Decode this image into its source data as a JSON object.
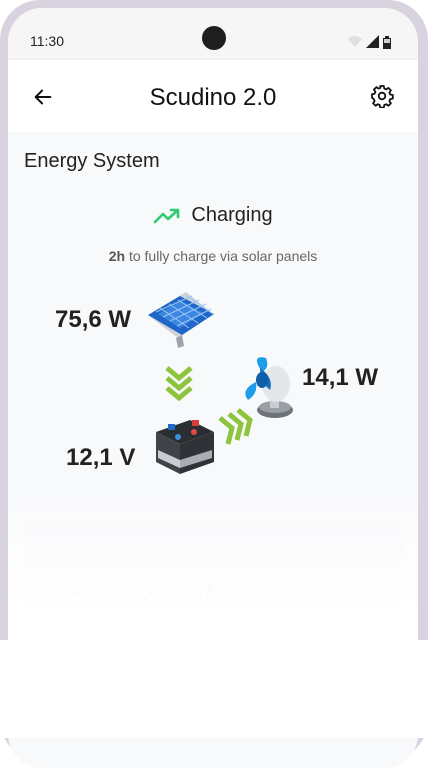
{
  "statusbar": {
    "time": "11:30",
    "icons": [
      "wifi-icon",
      "signal-icon",
      "battery-icon"
    ]
  },
  "appbar": {
    "title": "Scudino 2.0",
    "back_icon": "arrow-left-icon",
    "settings_icon": "gear-icon"
  },
  "energy": {
    "section_title": "Energy System",
    "status": "Charging",
    "status_icon": "trending-up-icon",
    "time_bold": "2h",
    "time_rest": " to fully charge via solar panels",
    "solar_power": "75,6 W",
    "load_power": "14,1 W",
    "battery_voltage": "12,1 V"
  },
  "colors": {
    "accent_green": "#2ecc71",
    "arrow_green": "#9bd83a",
    "chart_line": "#9be3a6"
  }
}
